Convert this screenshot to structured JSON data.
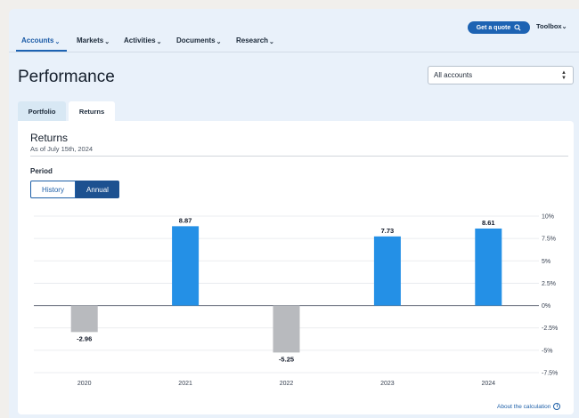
{
  "nav": {
    "items": [
      {
        "label": "Accounts"
      },
      {
        "label": "Markets"
      },
      {
        "label": "Activities"
      },
      {
        "label": "Documents"
      },
      {
        "label": "Research"
      }
    ],
    "quote_label": "Get a quote",
    "toolbox_label": "Toolbox"
  },
  "page": {
    "title": "Performance",
    "account_select": "All accounts"
  },
  "tabs": [
    {
      "label": "Portfolio"
    },
    {
      "label": "Returns"
    }
  ],
  "card": {
    "title": "Returns",
    "subtitle": "As of July 15th, 2024",
    "period_label": "Period",
    "segments": [
      "History",
      "Annual"
    ],
    "selected_segment": "Annual",
    "about_link": "About the calculation"
  },
  "colors": {
    "accent": "#1d63b3",
    "positive_bar": "#2490e6",
    "negative_bar": "#b8babe"
  },
  "chart_data": {
    "type": "bar",
    "categories": [
      "2020",
      "2021",
      "2022",
      "2023",
      "2024"
    ],
    "values": [
      -2.96,
      8.87,
      -5.25,
      7.73,
      8.61
    ],
    "value_labels": [
      "-2.96",
      "8.87",
      "-5.25",
      "7.73",
      "8.61"
    ],
    "y_ticks": [
      10,
      7.5,
      5,
      2.5,
      0,
      -2.5,
      -5,
      -7.5
    ],
    "y_tick_labels": [
      "10%",
      "7.5%",
      "5%",
      "2.5%",
      "0%",
      "-2.5%",
      "-5%",
      "-7.5%"
    ],
    "ylim": [
      -7.5,
      10
    ],
    "grid": true,
    "y_axis_side": "right"
  }
}
